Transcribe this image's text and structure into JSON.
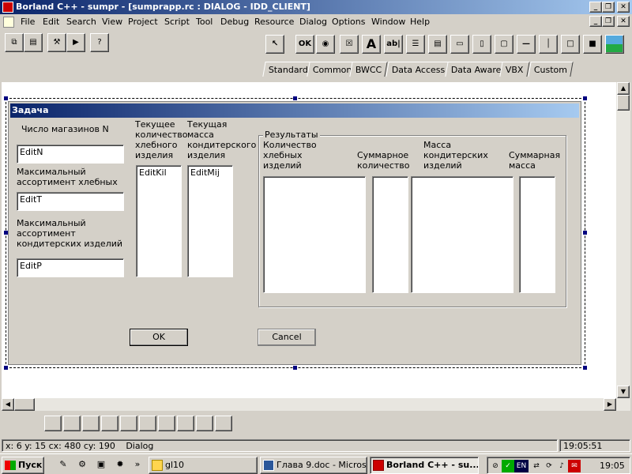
{
  "app": {
    "title": "Borland C++ - sumpr - [sumprapp.rc : DIALOG - IDD_CLIENT]"
  },
  "menu": [
    "File",
    "Edit",
    "Search",
    "View",
    "Project",
    "Script",
    "Tool",
    "Debug",
    "Resource",
    "Dialog",
    "Options",
    "Window",
    "Help"
  ],
  "palette_tabs": [
    "Standard",
    "Common",
    "BWCC",
    "Data Access",
    "Data Aware",
    "VBX",
    "Custom"
  ],
  "palette_icons": [
    "pointer-icon",
    "push-button-icon",
    "radio-button-icon",
    "checkbox-icon",
    "static-text-icon",
    "edit-text-icon",
    "listbox-icon",
    "combobox-icon",
    "horizontal-scrollbar-icon",
    "vertical-scrollbar-icon",
    "group-box-icon",
    "horizontal-line-icon",
    "vertical-line-icon",
    "frame-icon",
    "black-rect-icon",
    "bitmap-icon"
  ],
  "palette_glyphs": {
    "ok": "OK",
    "text": "A",
    "edit": "ab|"
  },
  "dialog": {
    "title": "Задача",
    "label_n": "Число магазинов N",
    "edit_n": "EditN",
    "label_t": "Максимальный ассортимент хлебных",
    "edit_t": "EditT",
    "label_p": "Максимальный ассортимент кондитерских изделий",
    "edit_p": "EditP",
    "label_kil": "Текущее количество хлебного изделия",
    "list_kil": "EditKil",
    "label_mij": "Текущая масса кондитерского изделия",
    "list_mij": "EditMij",
    "results_group": "Результаты",
    "col1": "Количество хлебных изделий",
    "col2": "Суммарное количество",
    "col3": "Масса кондитерских изделий",
    "col4": "Суммарная масса",
    "ok": "OK",
    "cancel": "Cancel"
  },
  "status": {
    "coords": "x: 6  y: 15  cx: 480  cy: 190",
    "mode": "Dialog",
    "time": "19:05:51"
  },
  "taskbar": {
    "start": "Пуск",
    "tasks": [
      "gl10",
      "Глава 9.doc - Micros...",
      "Borland C++ - su..."
    ],
    "lang": "EN",
    "clock": "19:05"
  },
  "colors": {
    "title_start": "#0a246a",
    "title_end": "#a6caf0",
    "face": "#d4d0c8"
  }
}
